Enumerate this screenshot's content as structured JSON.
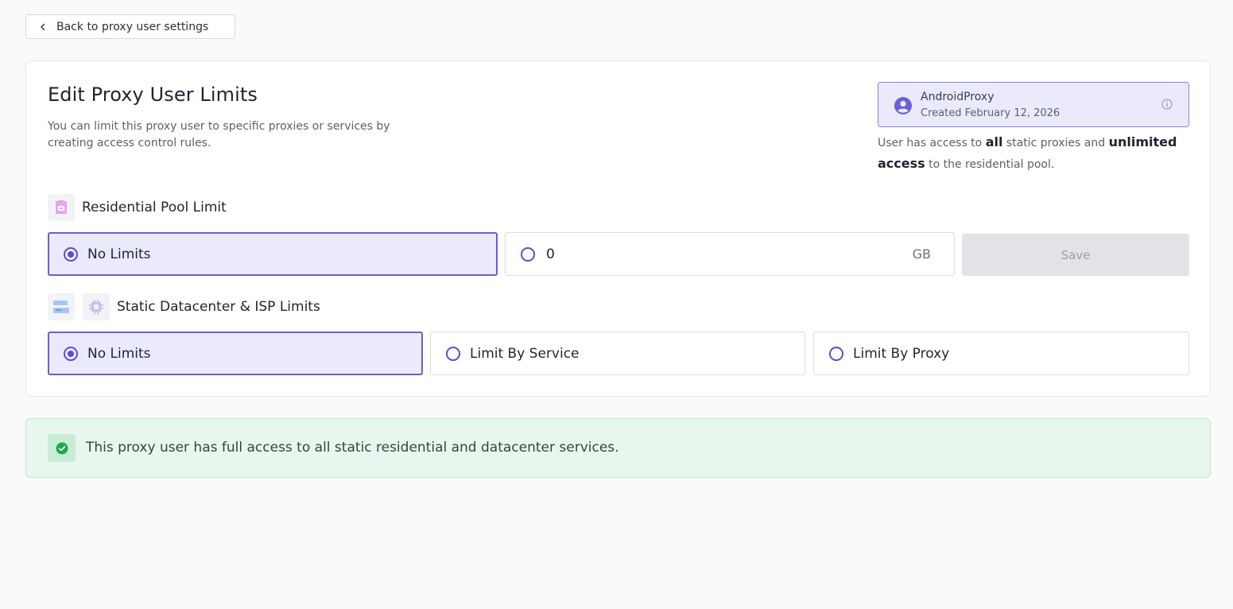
{
  "back_button": {
    "label": "Back to proxy user settings",
    "icon": "chevron-left-icon"
  },
  "header": {
    "title": "Edit Proxy User Limits",
    "description": "You can limit this proxy user to specific proxies or services by creating access control rules."
  },
  "user": {
    "name": "AndroidProxy",
    "created": "Created February 12, 2026",
    "access": {
      "prefix": "User has access to ",
      "all": "all",
      "middle": " static proxies and ",
      "unlimited": "unlimited access",
      "suffix": " to the residential pool."
    }
  },
  "residential": {
    "label": "Residential Pool Limit",
    "no_limits_label": "No Limits",
    "no_limits_selected": true,
    "gb_value": "0",
    "gb_unit": "GB",
    "save_label": "Save"
  },
  "static": {
    "label": "Static Datacenter & ISP Limits",
    "options": [
      {
        "label": "No Limits",
        "selected": true
      },
      {
        "label": "Limit By Service",
        "selected": false
      },
      {
        "label": "Limit By Proxy",
        "selected": false
      }
    ]
  },
  "banner": {
    "message": "This proxy user has full access to all static residential and datacenter services."
  },
  "colors": {
    "accent": "#5a4fc9",
    "selected_bg": "#ebeafc",
    "success_bg": "#e7f7ed",
    "success": "#22a851"
  }
}
